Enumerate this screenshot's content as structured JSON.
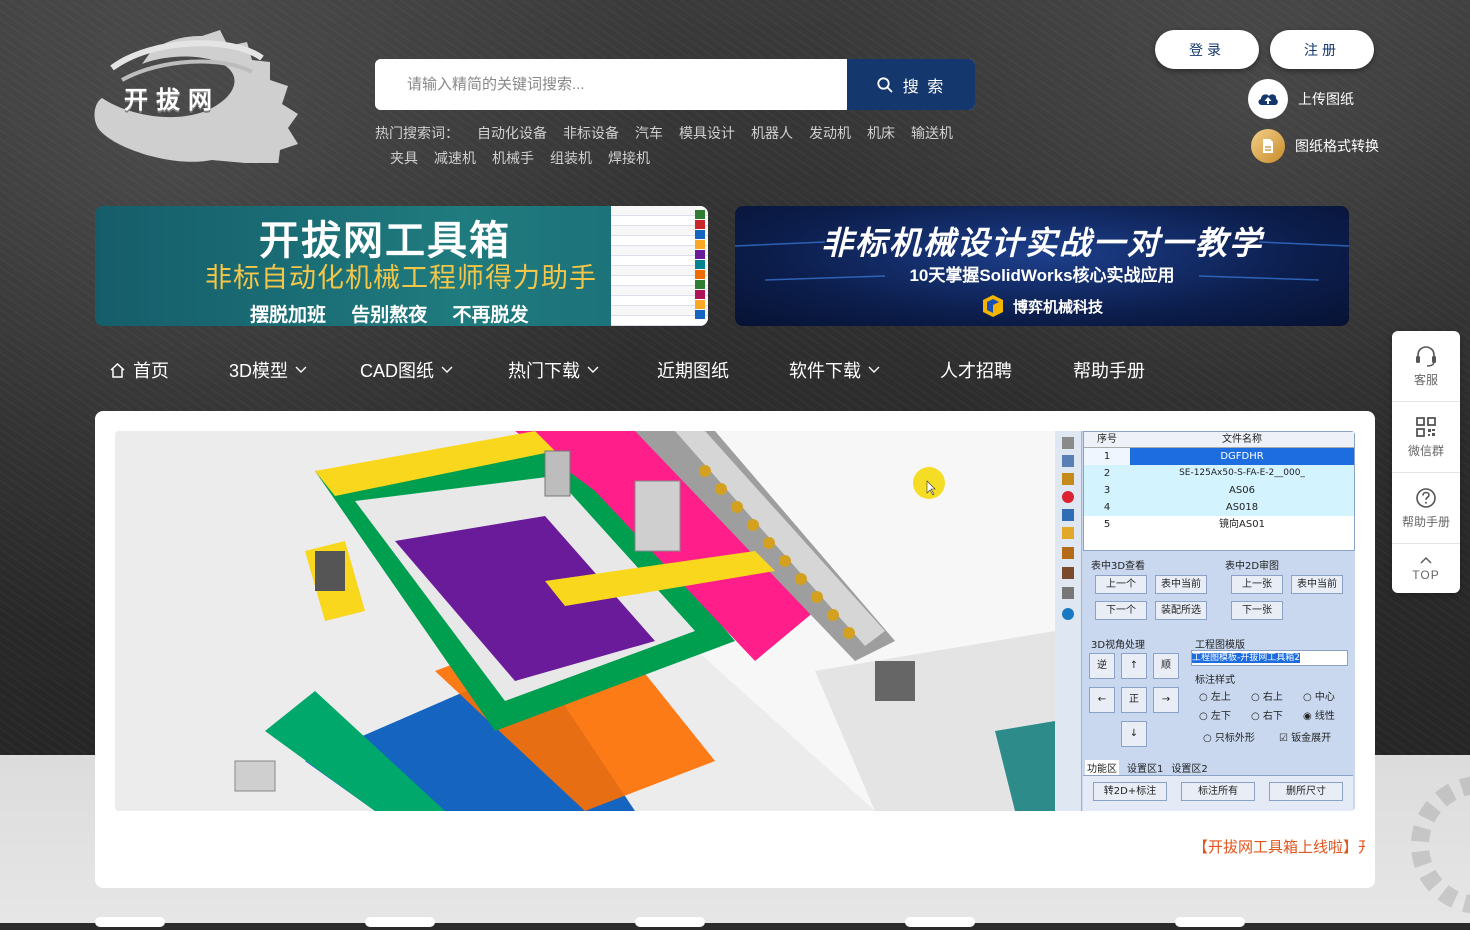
{
  "logo": {
    "text": "开拔网"
  },
  "search": {
    "placeholder": "请输入精简的关键词搜索...",
    "button_label": "搜 索"
  },
  "hot_search": {
    "label": "热门搜索词：",
    "keywords": [
      "自动化设备",
      "非标设备",
      "汽车",
      "模具设计",
      "机器人",
      "发动机",
      "机床",
      "输送机",
      "夹具",
      "减速机",
      "机械手",
      "组装机",
      "焊接机"
    ]
  },
  "auth": {
    "login": "登录",
    "register": "注册"
  },
  "tools": {
    "upload": "上传图纸",
    "convert": "图纸格式转换"
  },
  "banner_left": {
    "title": "开拔网工具箱",
    "subtitle": "非标自动化机械工程师得力助手",
    "tags": "摆脱加班 告别熬夜 不再脱发"
  },
  "banner_right": {
    "title": "非标机械设计实战一对一教学",
    "subtitle": "10天掌握SolidWorks核心实战应用",
    "brand": "博弈机械科技"
  },
  "nav": [
    {
      "label": "首页",
      "dropdown": false
    },
    {
      "label": "3D模型",
      "dropdown": true
    },
    {
      "label": "CAD图纸",
      "dropdown": true
    },
    {
      "label": "热门下载",
      "dropdown": true
    },
    {
      "label": "近期图纸",
      "dropdown": false
    },
    {
      "label": "软件下载",
      "dropdown": true
    },
    {
      "label": "人才招聘",
      "dropdown": false
    },
    {
      "label": "帮助手册",
      "dropdown": false
    }
  ],
  "slide_panel": {
    "table_headers": [
      "序号",
      "文件名称"
    ],
    "rows": [
      {
        "num": "1",
        "name": "DGFDHR"
      },
      {
        "num": "2",
        "name": "SE-125Ax50-S-FA-E-2__000_"
      },
      {
        "num": "3",
        "name": "AS06"
      },
      {
        "num": "4",
        "name": "AS018"
      },
      {
        "num": "5",
        "name": "镜向AS01"
      }
    ],
    "group_3d": "表中3D查看",
    "group_2d": "表中2D审图",
    "btn_prev": "上一个",
    "btn_current": "表中当前",
    "btn_prev_sheet": "上一张",
    "btn_next": "下一个",
    "btn_assembly": "装配所选",
    "btn_next_sheet": "下一张",
    "view_label": "3D视角处理",
    "template_label": "工程图模版",
    "template_value": "工程图模板-开拔网工具箱2",
    "annotation_label": "标注样式",
    "view_buttons": [
      "逆",
      "↑",
      "顺",
      "←",
      "正",
      "→",
      "↓"
    ],
    "annotation_options": [
      "左上",
      "右上",
      "中心",
      "左下",
      "右下",
      "线性"
    ],
    "only_outline": "只标外形",
    "sheet_unfold": "钣金展开",
    "tabs": [
      "功能区",
      "设置区1",
      "设置区2"
    ],
    "bottom_buttons": [
      "转2D+标注",
      "标注所有",
      "删所尺寸"
    ]
  },
  "ticker": "【开拔网工具箱上线啦】开",
  "side_panel": [
    {
      "label": "客服",
      "icon": "headset-icon"
    },
    {
      "label": "微信群",
      "icon": "qrcode-icon"
    },
    {
      "label": "帮助手册",
      "icon": "question-icon"
    },
    {
      "label": "TOP",
      "icon": "arrow-up-icon"
    }
  ],
  "colors": {
    "primary": "#14376e",
    "accent": "#e0541d",
    "panel_blue": "#c9d8ef"
  }
}
